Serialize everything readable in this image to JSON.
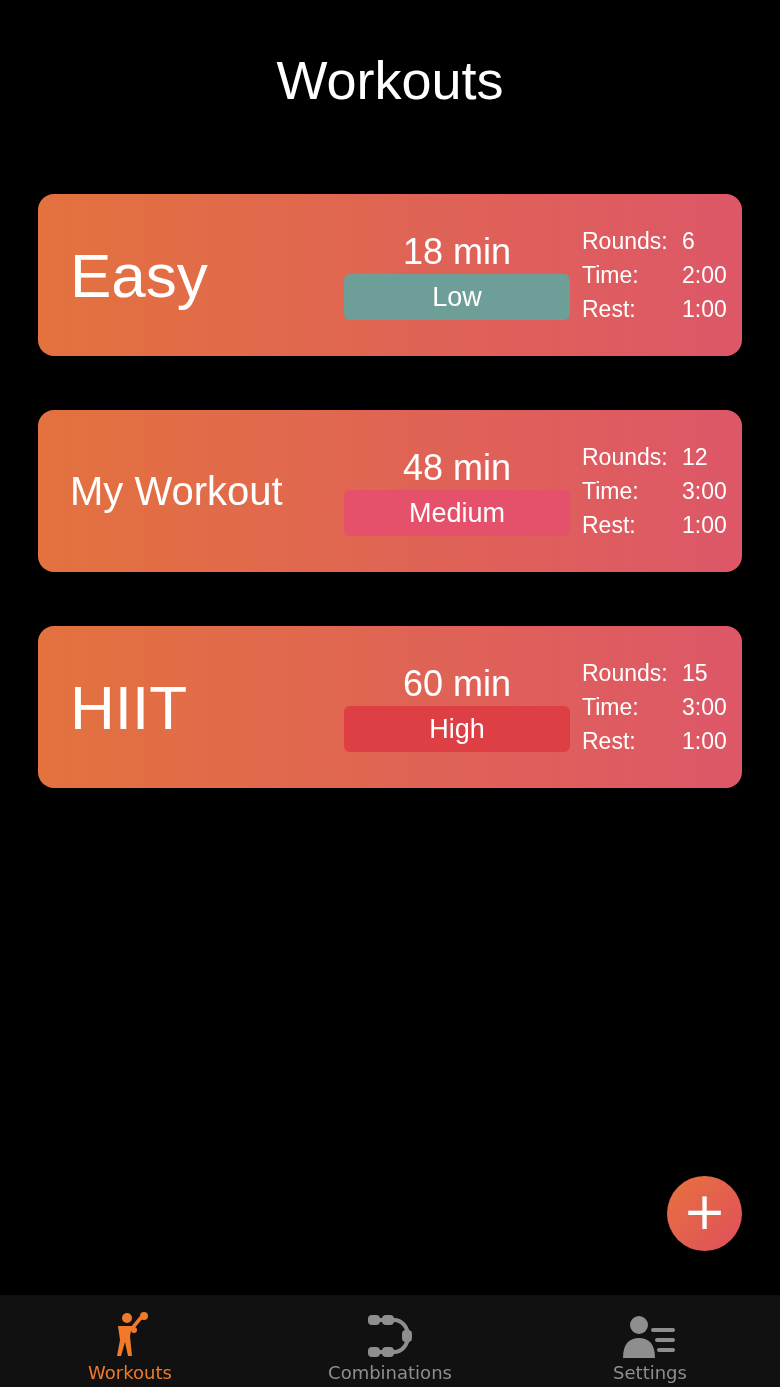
{
  "title": "Workouts",
  "workouts": [
    {
      "name": "Easy",
      "duration": "18 min",
      "intensity": "Low",
      "color": "#6e9e98",
      "stats": [
        {
          "label": "Rounds:",
          "value": "6"
        },
        {
          "label": "Time:",
          "value": "2:00"
        },
        {
          "label": "Rest:",
          "value": "1:00"
        }
      ]
    },
    {
      "name": "My Workout",
      "duration": "48 min",
      "intensity": "Medium",
      "color": "#e5506a",
      "stats": [
        {
          "label": "Rounds:",
          "value": "12"
        },
        {
          "label": "Time:",
          "value": "3:00"
        },
        {
          "label": "Rest:",
          "value": "1:00"
        }
      ]
    },
    {
      "name": "HIIT",
      "duration": "60 min",
      "intensity": "High",
      "color": "#de3f45",
      "stats": [
        {
          "label": "Rounds:",
          "value": "15"
        },
        {
          "label": "Time:",
          "value": "3:00"
        },
        {
          "label": "Rest:",
          "value": "1:00"
        }
      ]
    }
  ],
  "add_button": "+",
  "tabs": [
    {
      "label": "Workouts",
      "kind": "boxer",
      "selected": true
    },
    {
      "label": "Combinations",
      "kind": "chain",
      "selected": false
    },
    {
      "label": "Settings",
      "kind": "profile",
      "selected": false
    }
  ]
}
